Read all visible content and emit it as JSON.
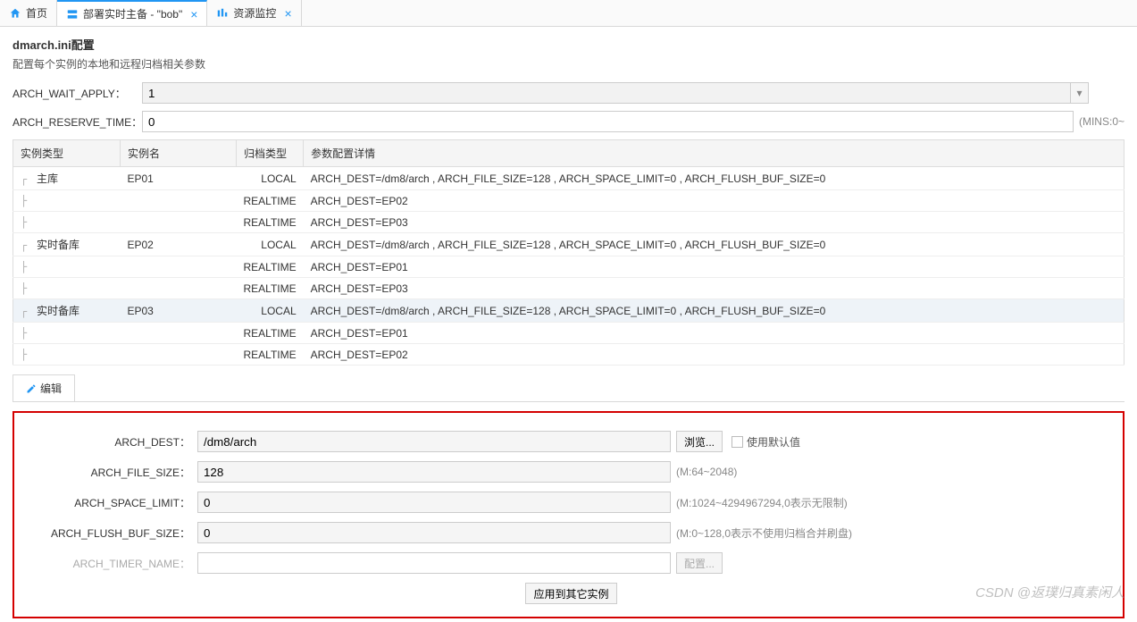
{
  "tabs": [
    {
      "label": "首页",
      "icon": "home"
    },
    {
      "label": "部署实时主备 - \"bob\"",
      "icon": "server",
      "closable": true
    },
    {
      "label": "资源监控",
      "icon": "monitor",
      "closable": true
    }
  ],
  "config": {
    "title": "dmarch.ini配置",
    "subtitle": "配置每个实例的本地和远程归档相关参数",
    "arch_wait_apply_label": "ARCH_WAIT_APPLY：",
    "arch_wait_apply_value": "1",
    "arch_reserve_time_label": "ARCH_RESERVE_TIME：",
    "arch_reserve_time_value": "0",
    "arch_reserve_time_hint": "(MINS:0~"
  },
  "grid": {
    "headers": [
      "实例类型",
      "实例名",
      "归档类型",
      "参数配置详情"
    ],
    "rows": [
      {
        "type": "主库",
        "name": "EP01",
        "arch": "LOCAL",
        "detail": "ARCH_DEST=/dm8/arch , ARCH_FILE_SIZE=128 , ARCH_SPACE_LIMIT=0 , ARCH_FLUSH_BUF_SIZE=0",
        "depth": 0
      },
      {
        "type": "",
        "name": "",
        "arch": "REALTIME",
        "detail": "ARCH_DEST=EP02",
        "depth": 1
      },
      {
        "type": "",
        "name": "",
        "arch": "REALTIME",
        "detail": "ARCH_DEST=EP03",
        "depth": 1
      },
      {
        "type": "实时备库",
        "name": "EP02",
        "arch": "LOCAL",
        "detail": "ARCH_DEST=/dm8/arch , ARCH_FILE_SIZE=128 , ARCH_SPACE_LIMIT=0 , ARCH_FLUSH_BUF_SIZE=0",
        "depth": 0
      },
      {
        "type": "",
        "name": "",
        "arch": "REALTIME",
        "detail": "ARCH_DEST=EP01",
        "depth": 1
      },
      {
        "type": "",
        "name": "",
        "arch": "REALTIME",
        "detail": "ARCH_DEST=EP03",
        "depth": 1
      },
      {
        "type": "实时备库",
        "name": "EP03",
        "arch": "LOCAL",
        "detail": "ARCH_DEST=/dm8/arch , ARCH_FILE_SIZE=128 , ARCH_SPACE_LIMIT=0 , ARCH_FLUSH_BUF_SIZE=0",
        "depth": 0,
        "selected": true
      },
      {
        "type": "",
        "name": "",
        "arch": "REALTIME",
        "detail": "ARCH_DEST=EP01",
        "depth": 1
      },
      {
        "type": "",
        "name": "",
        "arch": "REALTIME",
        "detail": "ARCH_DEST=EP02",
        "depth": 1
      }
    ]
  },
  "subtab": {
    "edit_label": "编辑"
  },
  "edit": {
    "arch_dest_label": "ARCH_DEST：",
    "arch_dest_value": "/dm8/arch",
    "browse_label": "浏览...",
    "use_default_label": "使用默认值",
    "arch_file_size_label": "ARCH_FILE_SIZE：",
    "arch_file_size_value": "128",
    "arch_file_size_hint": "(M:64~2048)",
    "arch_space_limit_label": "ARCH_SPACE_LIMIT：",
    "arch_space_limit_value": "0",
    "arch_space_limit_hint": "(M:1024~4294967294,0表示无限制)",
    "arch_flush_buf_size_label": "ARCH_FLUSH_BUF_SIZE：",
    "arch_flush_buf_size_value": "0",
    "arch_flush_buf_size_hint": "(M:0~128,0表示不使用归档合并刷盘)",
    "arch_timer_name_label": "ARCH_TIMER_NAME：",
    "arch_timer_name_value": "",
    "config_btn_label": "配置...",
    "apply_label": "应用到其它实例"
  },
  "watermark": "CSDN @返璞归真素闲人"
}
